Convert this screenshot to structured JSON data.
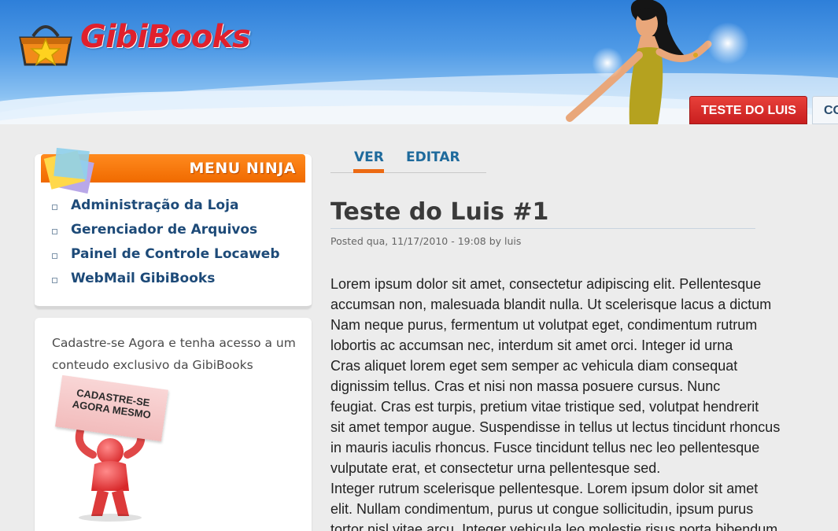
{
  "header": {
    "logo_text": "GibiBooks",
    "nav_tabs": [
      {
        "label": "TESTE DO LUIS",
        "active": true
      },
      {
        "label": "CO",
        "active": false
      }
    ]
  },
  "sidebar": {
    "menu_title": "MENU NINJA",
    "items": [
      {
        "label": "Administração da Loja"
      },
      {
        "label": "Gerenciador de Arquivos"
      },
      {
        "label": "Painel de Controle Locaweb"
      },
      {
        "label": "WebMail GibiBooks"
      }
    ],
    "signup": {
      "text": "Cadastre-se Agora e tenha acesso a um conteudo exclusivo da GibiBooks",
      "sign_line1": "CADASTRE-SE",
      "sign_line2": "AGORA MESMO"
    }
  },
  "main": {
    "tabs": [
      {
        "label": "VER",
        "active": true
      },
      {
        "label": "EDITAR",
        "active": false
      }
    ],
    "title": "Teste do Luis #1",
    "submitted": "Posted qua, 11/17/2010 - 19:08 by luis",
    "body_lines": [
      "Lorem ipsum dolor sit amet, consectetur adipiscing elit. Pellentesque",
      "accumsan non, malesuada blandit nulla. Ut scelerisque lacus a dictum",
      "Nam neque purus, fermentum ut volutpat eget, condimentum rutrum",
      "lobortis ac accumsan nec, interdum sit amet orci. Integer id urna",
      "Cras aliquet lorem eget sem semper ac vehicula diam consequat",
      "dignissim tellus. Cras et nisi non massa posuere cursus. Nunc",
      "feugiat. Cras est turpis, pretium vitae tristique sed, volutpat hendrerit",
      "sit amet tempor augue. Suspendisse in tellus ut lectus tincidunt rhoncus",
      "in mauris iaculis rhoncus. Fusce tincidunt tellus nec leo pellentesque",
      "vulputate erat, et consectetur urna pellentesque sed.",
      "Integer rutrum scelerisque pellentesque. Lorem ipsum dolor sit amet",
      "elit. Nullam condimentum, purus ut congue sollicitudin, ipsum purus",
      "tortor nisl vitae arcu. Integer vehicula leo molestie risus porta bibendum"
    ]
  },
  "colors": {
    "accent_red": "#e0202d",
    "menu_orange": "#f06a00",
    "link_blue": "#1d4a78",
    "tab_underline": "#ec6a13"
  }
}
